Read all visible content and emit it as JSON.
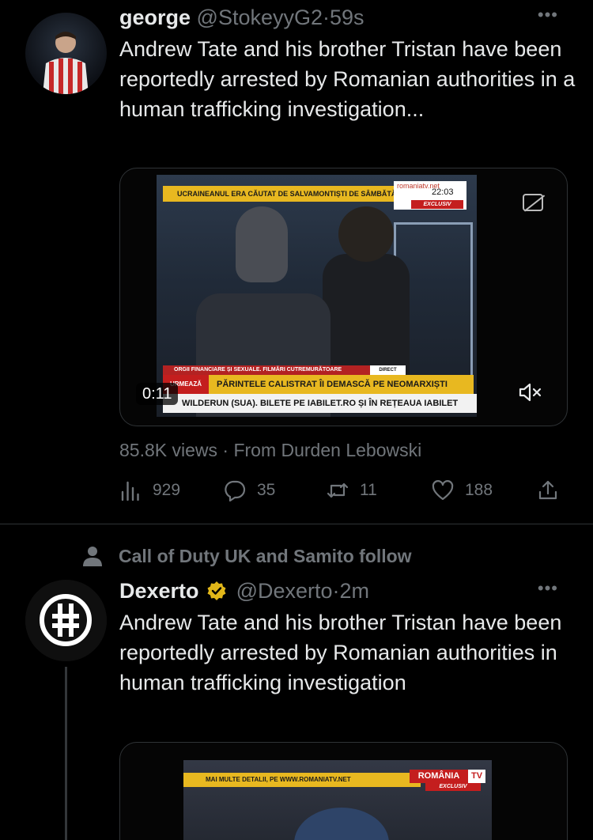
{
  "tweet1": {
    "name": "george",
    "handle": "@StokeyyG2",
    "separator": "·",
    "time": "59s",
    "text": "Andrew Tate and his brother Tristan have been reportedly arrested by Romanian authorities in a human trafficking investigation...",
    "video": {
      "ticker_top": "UCRAINEANUL ERA CĂUTAT DE SALVAMONTIȘTI DE SÂMBĂTĂ",
      "channel_brand": "romaniatv.net",
      "clock": "22:03",
      "exclusive_label": "EXCLUSIV",
      "lower_red": "ORGII FINANCIARE ȘI SEXUALE. FILMĂRI CUTREMURĂTOARE",
      "direct_label": "DIRECT",
      "next_label": "URMEAZĂ",
      "lower_yellow": "PĂRINTELE CALISTRAT ÎI DEMASCĂ PE NEOMARXIȘTI",
      "lower_white": "WILDERUN (SUA). BILETE PE IABILET.RO ȘI ÎN REȚEAUA IABILET",
      "duration": "0:11"
    },
    "meta": "85.8K views · From Durden Lebowski",
    "actions": {
      "views": "929",
      "replies": "35",
      "retweets": "11",
      "likes": "188"
    }
  },
  "tweet2": {
    "social_context": "Call of Duty UK and Samito follow",
    "name": "Dexerto",
    "handle": "@Dexerto",
    "separator": "·",
    "time": "2m",
    "text": "Andrew Tate and his brother Tristan have been reportedly arrested by Romanian authorities in human trafficking investigation",
    "video": {
      "ticker_top": "MAI MULTE DETALII, PE WWW.ROMANIATV.NET",
      "brand": "ROMÂNIA",
      "brand_tv": "TV",
      "exclusive_label": "EXCLUSIV"
    }
  },
  "icons": {
    "more": "more-icon",
    "captions_off": "captions-off-icon",
    "mute": "mute-icon",
    "views": "views-icon",
    "reply": "reply-icon",
    "retweet": "retweet-icon",
    "like": "like-icon",
    "share": "share-icon",
    "person": "person-icon",
    "verified": "verified-badge-icon"
  },
  "colors": {
    "background": "#000000",
    "text_primary": "#e7e9ea",
    "text_secondary": "#71767b",
    "divider": "#2f3336",
    "verified_gold": "#e2b719"
  }
}
